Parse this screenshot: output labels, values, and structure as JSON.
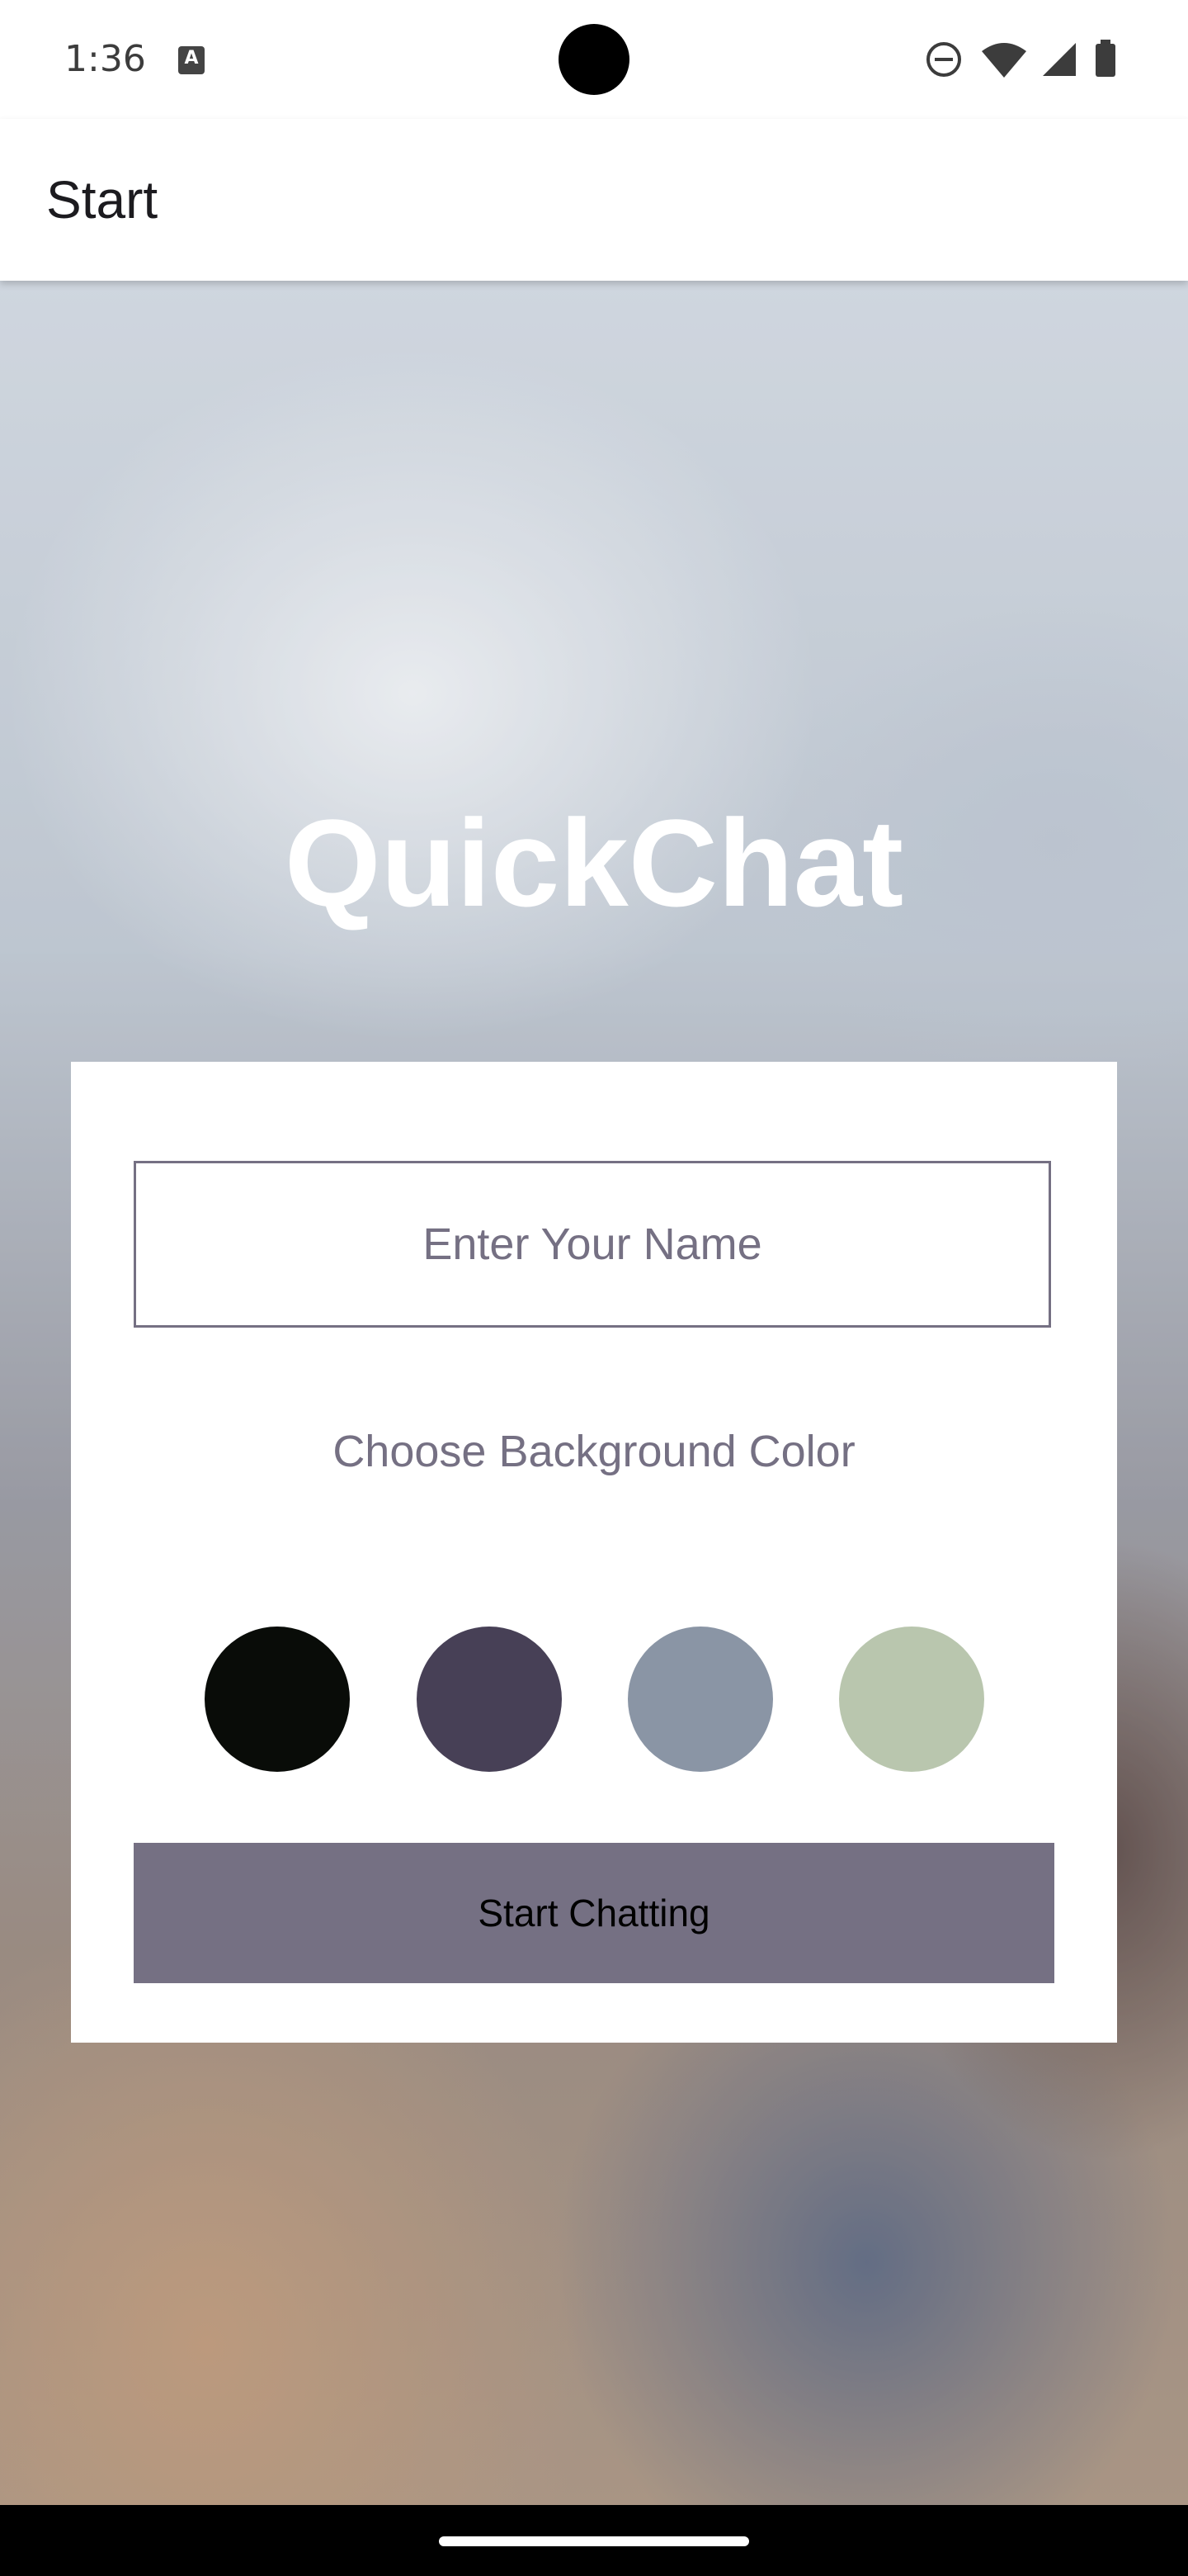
{
  "status_bar": {
    "time": "1:36",
    "icons": [
      "text-input-icon",
      "do-not-disturb-icon",
      "wifi-icon",
      "signal-icon",
      "battery-icon"
    ]
  },
  "app_bar": {
    "title": "Start"
  },
  "main": {
    "app_title": "QuickChat",
    "name_input": {
      "placeholder": "Enter Your Name",
      "value": ""
    },
    "choose_label": "Choose Background Color",
    "color_options": [
      {
        "color": "#090C08",
        "name": "black"
      },
      {
        "color": "#474056",
        "name": "purple"
      },
      {
        "color": "#8A95A5",
        "name": "grey"
      },
      {
        "color": "#B9C6AE",
        "name": "green"
      }
    ],
    "start_button_label": "Start Chatting",
    "accent_color": "#757083"
  }
}
